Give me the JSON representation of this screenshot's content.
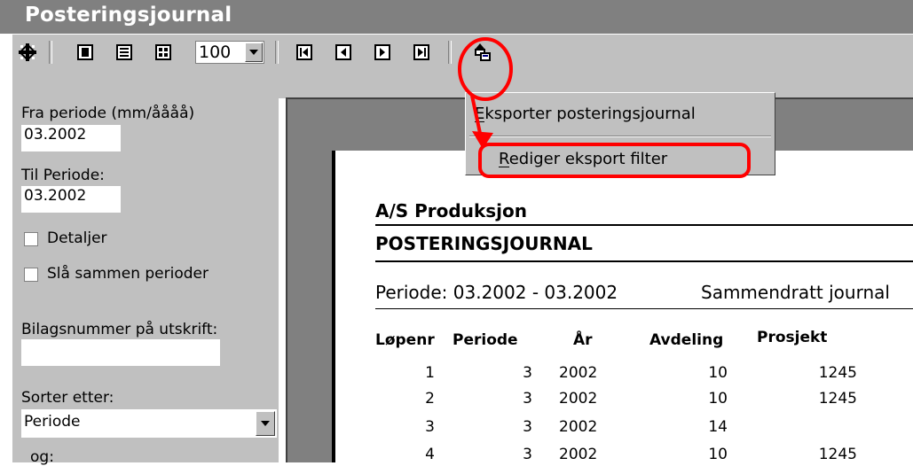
{
  "window": {
    "title": "Posteringsjournal"
  },
  "toolbar": {
    "zoom_value": "100",
    "icons": [
      "settings-icon",
      "one-page-icon",
      "two-page-icon",
      "multi-page-icon",
      "first-page-icon",
      "prev-page-icon",
      "next-page-icon",
      "last-page-icon",
      "export-icon"
    ]
  },
  "sidebar": {
    "from_period_label": "Fra periode (mm/åååå)",
    "from_period_value": "03.2002",
    "to_period_label": "Til Periode:",
    "to_period_value": "03.2002",
    "details_label": "Detaljer",
    "merge_periods_label": "Slå sammen perioder",
    "voucher_label": "Bilagsnummer på utskrift:",
    "voucher_value": "",
    "sort_label": "Sorter etter:",
    "sort_value": "Periode",
    "and_label": "og:"
  },
  "context_menu": {
    "item1": "Eksporter posteringsjournal",
    "item2": "Rediger eksport filter"
  },
  "report": {
    "company": "A/S Produksjon",
    "title": "POSTERINGSJOURNAL",
    "period": "Periode: 03.2002 - 03.2002",
    "mode": "Sammendratt journal",
    "columns": [
      "Løpenr",
      "Periode",
      "År",
      "Avdeling",
      "Prosjekt"
    ],
    "rows": [
      [
        "1",
        "3",
        "2002",
        "10",
        "1245"
      ],
      [
        "2",
        "3",
        "2002",
        "10",
        "1245"
      ],
      [
        "3",
        "3",
        "2002",
        "14",
        ""
      ],
      [
        "4",
        "3",
        "2002",
        "10",
        "1245"
      ]
    ]
  },
  "colors": {
    "annotation": "#ff0000",
    "window_bg": "#c0c0c0",
    "title_bg": "#808080"
  }
}
